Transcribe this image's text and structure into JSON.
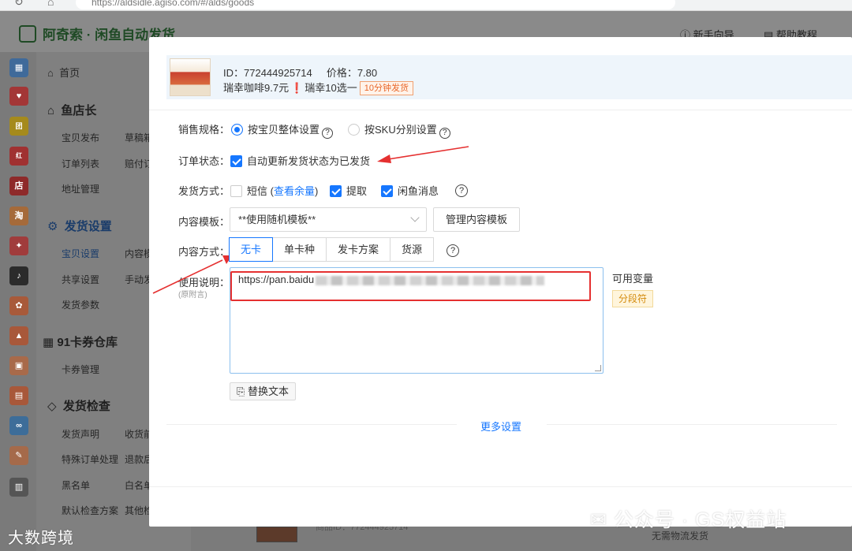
{
  "browser": {
    "url": "https://aldsidle.agiso.com/#/alds/goods"
  },
  "app": {
    "title": "阿奇索 · 闲鱼自动发货",
    "header_links": [
      "新手向导",
      "帮助教程"
    ]
  },
  "sidebar": {
    "home": "首页",
    "sections": [
      {
        "title": "鱼店长",
        "items": [
          "宝贝发布",
          "草稿箱",
          "订单列表",
          "赔付订",
          "地址管理"
        ]
      },
      {
        "title": "发货设置",
        "items": [
          "宝贝设置",
          "内容模",
          "共享设置",
          "手动发",
          "发货参数"
        ]
      },
      {
        "title": "91卡券仓库",
        "items": [
          "卡券管理"
        ]
      },
      {
        "title": "发货检查",
        "items": [
          "发货声明",
          "收货前",
          "特殊订单处理",
          "退款后",
          "黑名单",
          "白名单",
          "默认检查方案",
          "其他检"
        ]
      }
    ]
  },
  "goods": {
    "id_label": "ID：772444925714",
    "price_label": "价格：7.80",
    "title": "瑞幸咖啡9.7元",
    "title_mark": "❗",
    "title_tail": "瑞幸10选一",
    "tag": "10分钟发货"
  },
  "form": {
    "sales_spec": {
      "label": "销售规格：",
      "option_whole": "按宝贝整体设置",
      "option_sku": "按SKU分别设置"
    },
    "order_status": {
      "label": "订单状态：",
      "checkbox": "自动更新发货状态为已发货"
    },
    "ship_method": {
      "label": "发货方式：",
      "sms": "短信",
      "sms_link": "查看余量",
      "pickup": "提取",
      "xianyu_msg": "闲鱼消息"
    },
    "template": {
      "label": "内容模板：",
      "selected": "**使用随机模板**",
      "manage_button": "管理内容模板"
    },
    "content_mode": {
      "label": "内容方式：",
      "tabs": [
        "无卡",
        "单卡种",
        "发卡方案",
        "货源"
      ],
      "active": "无卡"
    },
    "usage": {
      "label": "使用说明：",
      "sublabel": "(原附言)",
      "value": "https://pan.baidu",
      "variables_title": "可用变量",
      "variable_tag": "分段符",
      "replace_button": "替换文本"
    },
    "more_settings": "更多设置"
  },
  "background": {
    "bottom_text_1": "商品ID：772444925714",
    "bottom_text_2": "无需物流发货"
  },
  "watermarks": {
    "left": "大数跨境",
    "right": "公众号 · GS权益站"
  },
  "colors": {
    "accent": "#1677ff",
    "annotation_red": "#e53030",
    "tag_orange": "#e8672a"
  }
}
